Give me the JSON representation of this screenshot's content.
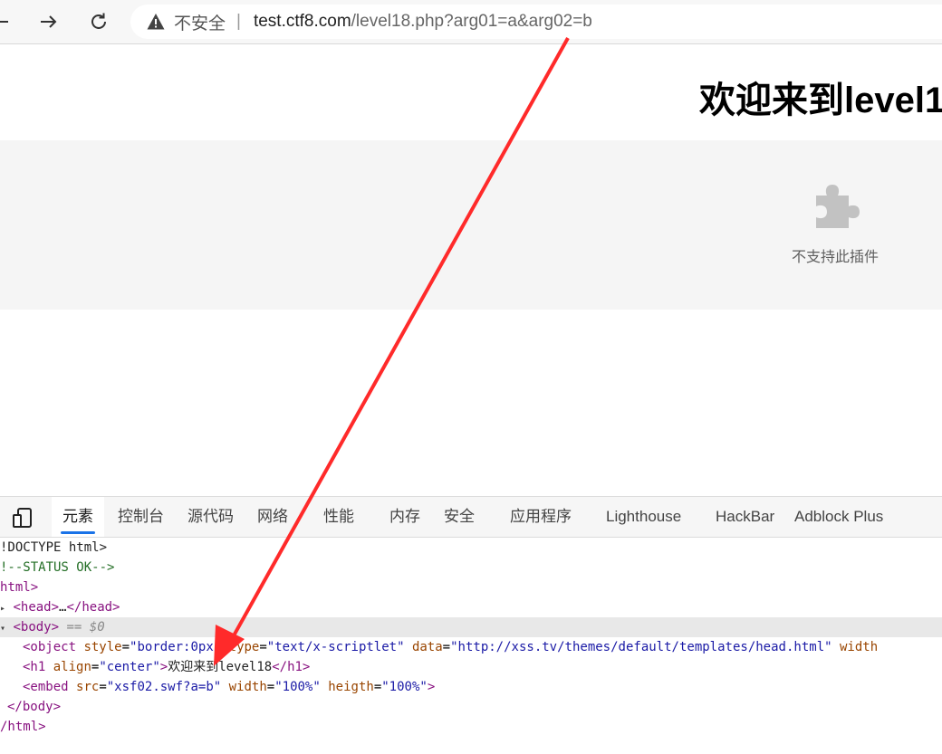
{
  "browser": {
    "insecure_label": "不安全",
    "separator": "|",
    "url_host": "test.ctf8.com",
    "url_path": "/level18.php?arg01=a&arg02=b"
  },
  "page": {
    "title": "欢迎来到level1",
    "plugin_message": "不支持此插件"
  },
  "devtools": {
    "tabs": [
      "元素",
      "控制台",
      "源代码",
      "网络",
      "性能",
      "内存",
      "安全",
      "应用程序",
      "Lighthouse",
      "HackBar",
      "Adblock Plus"
    ],
    "dom": {
      "doctype": "!DOCTYPE html>",
      "comment": "!--STATUS OK-->",
      "html_open": "html>",
      "head_open": "<head>",
      "head_ellipsis": "…",
      "head_close": "</head>",
      "body_open": "<body>",
      "body_selected_marker": "== $0",
      "object_tag": "<object",
      "object_attr1": "style",
      "object_val1": "\"border:0px\"",
      "object_attr2": "type",
      "object_val2": "\"text/x-scriptlet\"",
      "object_attr3": "data",
      "object_val3": "\"http://xss.tv/themes/default/templates/head.html\"",
      "object_attr4": "width",
      "h1_open": "<h1",
      "h1_attr": "align",
      "h1_val": "\"center\"",
      "h1_text": "欢迎来到level18",
      "h1_close": "</h1>",
      "embed_tag": "<embed",
      "embed_attr1": "src",
      "embed_val1": "\"xsf02.swf?a=b\"",
      "embed_attr2": "width",
      "embed_val2": "\"100%\"",
      "embed_attr3": "heigth",
      "embed_val3": "\"100%\"",
      "embed_close": ">",
      "body_close": "</body>",
      "html_close": "/html>"
    }
  },
  "colors": {
    "accent": "#1a73e8",
    "annotation": "#ff2a2a"
  }
}
